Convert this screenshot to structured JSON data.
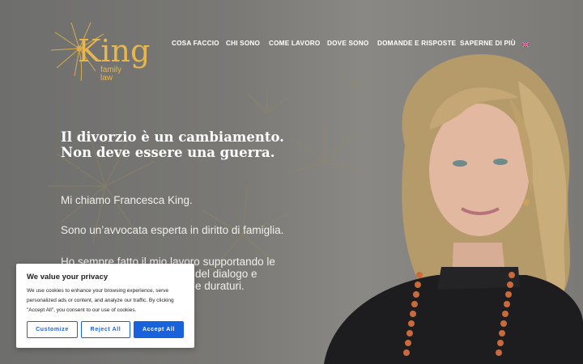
{
  "brand": {
    "name": "King",
    "subtitle_line1": "family",
    "subtitle_line2": "law"
  },
  "nav": {
    "items": [
      {
        "label": "COSA FACCIO"
      },
      {
        "label": "CHI SONO"
      },
      {
        "label": "COME LAVORO"
      },
      {
        "label": "DOVE SONO"
      },
      {
        "label": "DOMANDE E RISPOSTE"
      },
      {
        "label": "SAPERNE DI PIÙ"
      }
    ],
    "language_icon": "uk-flag-icon"
  },
  "hero": {
    "headline_line1": "Il divorzio è un cambiamento.",
    "headline_line2": "Non deve essere una guerra.",
    "para1": "Mi chiamo Francesca King.",
    "para2": "Sono un’avvocata esperta in diritto di famiglia.",
    "para3_line1": "Ho sempre fatto il mio lavoro supportando le",
    "para3_line2": "del dialogo e",
    "para3_line3": "e duraturi."
  },
  "cookie": {
    "title": "We value your privacy",
    "body_line1": "We use cookies to enhance your browsing experience, serve",
    "body_line2": "personalized ads or content, and analyze our traffic. By clicking",
    "body_line3": "\"Accept All\", you consent to our use of cookies.",
    "customize_label": "Customize",
    "reject_label": "Reject All",
    "accept_label": "Accept All"
  },
  "colors": {
    "accent_gold": "#e8b64c",
    "button_blue": "#1863dc"
  }
}
